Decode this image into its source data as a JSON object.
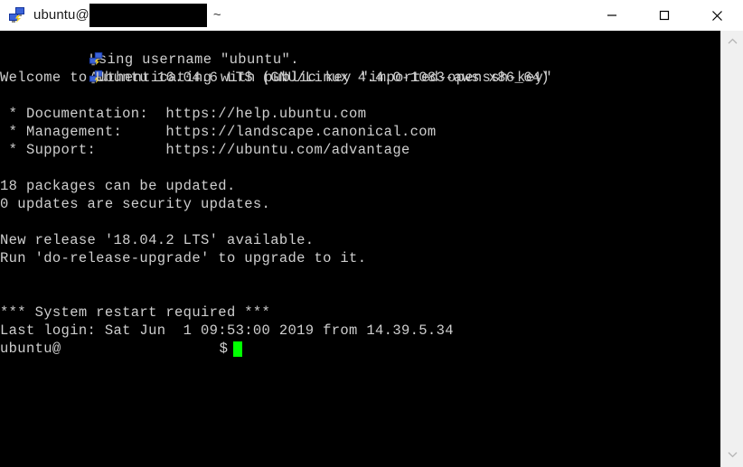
{
  "window": {
    "title_prefix": "ubuntu@",
    "title_host_redacted": true,
    "title_suffix": "~",
    "app_icon": "putty-network-computer-icon",
    "minimize_label": "Minimize",
    "maximize_label": "Maximize",
    "close_label": "Close"
  },
  "terminal": {
    "background": "#000000",
    "foreground": "#cfcfcf",
    "cursor_color": "#00ff00",
    "lines": [
      {
        "icon": "putty-network-computer-icon",
        "text": "Using username \"ubuntu\"."
      },
      {
        "icon": "putty-network-computer-icon",
        "text": "Authenticating with public key \"imported-openssh-key\""
      },
      {
        "icon": null,
        "text": "Welcome to Ubuntu 16.04.6 LTS (GNU/Linux 4.4.0-1083-aws x86_64)"
      },
      {
        "icon": null,
        "text": ""
      },
      {
        "icon": null,
        "text": " * Documentation:  https://help.ubuntu.com"
      },
      {
        "icon": null,
        "text": " * Management:     https://landscape.canonical.com"
      },
      {
        "icon": null,
        "text": " * Support:        https://ubuntu.com/advantage"
      },
      {
        "icon": null,
        "text": ""
      },
      {
        "icon": null,
        "text": "18 packages can be updated."
      },
      {
        "icon": null,
        "text": "0 updates are security updates."
      },
      {
        "icon": null,
        "text": ""
      },
      {
        "icon": null,
        "text": "New release '18.04.2 LTS' available."
      },
      {
        "icon": null,
        "text": "Run 'do-release-upgrade' to upgrade to it."
      },
      {
        "icon": null,
        "text": ""
      },
      {
        "icon": null,
        "text": ""
      },
      {
        "icon": null,
        "text": "*** System restart required ***"
      },
      {
        "icon": null,
        "text": "Last login: Sat Jun  1 09:53:00 2019 from 14.39.5.34"
      }
    ],
    "prompt": {
      "user_at": "ubuntu@",
      "host_redacted": true,
      "symbol": "$",
      "cursor": "block"
    }
  },
  "scrollbar": {
    "up_arrow": "chevron-up-icon",
    "down_arrow": "chevron-down-icon",
    "track_color": "#f0f0f0"
  }
}
